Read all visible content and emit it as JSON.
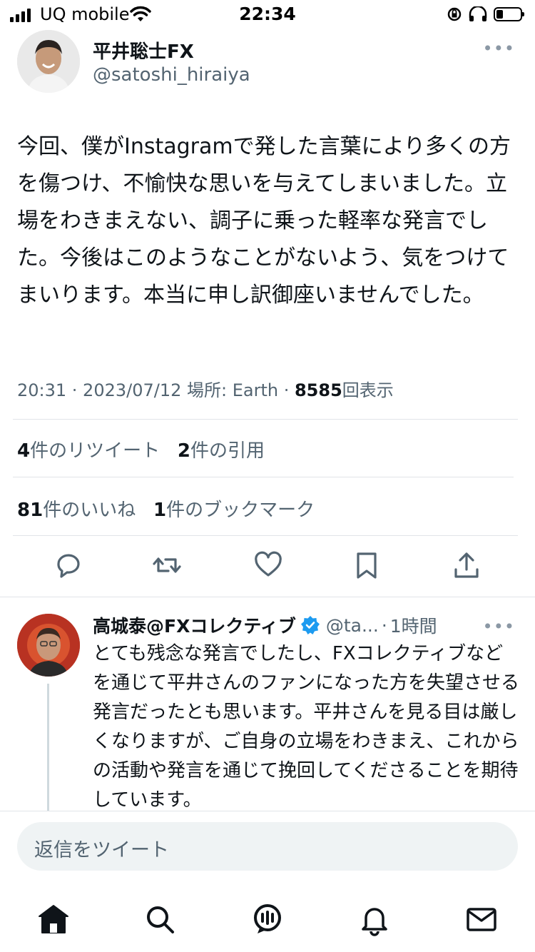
{
  "status_bar": {
    "carrier": "UQ mobile",
    "time": "22:34"
  },
  "tweet": {
    "author_name": "平井聡士FX",
    "author_handle": "@satoshi_hiraiya",
    "text": "今回、僕がInstagramで発した言葉により多くの方を傷つけ、不愉快な思いを与えてしまいました。立場をわきまえない、調子に乗った軽率な発言でした。今後はこのようなことがないよう、気をつけてまいります。本当に申し訳御座いませんでした。",
    "meta_prefix": "20:31 · 2023/07/12 場所: Earth · ",
    "views_count": "8585",
    "views_label": "回表示",
    "retweets_count": "4",
    "retweets_label": "件のリツイート",
    "quotes_count": "2",
    "quotes_label": "件の引用",
    "likes_count": "81",
    "likes_label": "件のいいね",
    "bookmarks_count": "1",
    "bookmarks_label": "件のブックマーク",
    "more": "•••"
  },
  "reply": {
    "author_name": "高城泰@FXコレクティブ",
    "author_handle": "@ta...",
    "time": "1時間",
    "text": "とても残念な発言でしたし、FXコレクティブなどを通じて平井さんのファンになった方を失望させる発言だったとも思います。平井さんを見る目は厳しくなりますが、ご自身の立場をわきまえ、これからの活動や発言を通じて挽回してくださることを期待しています。",
    "more": "•••"
  },
  "composer": {
    "placeholder": "返信をツイート"
  },
  "colors": {
    "accent": "#1d9bf0",
    "text": "#0f1419",
    "secondary": "#536471",
    "divider": "#e1e4e8"
  },
  "icons": [
    "reply-icon",
    "retweet-icon",
    "like-icon",
    "bookmark-icon",
    "share-icon",
    "home-icon",
    "search-icon",
    "spaces-icon",
    "notifications-icon",
    "messages-icon",
    "verified-icon"
  ]
}
